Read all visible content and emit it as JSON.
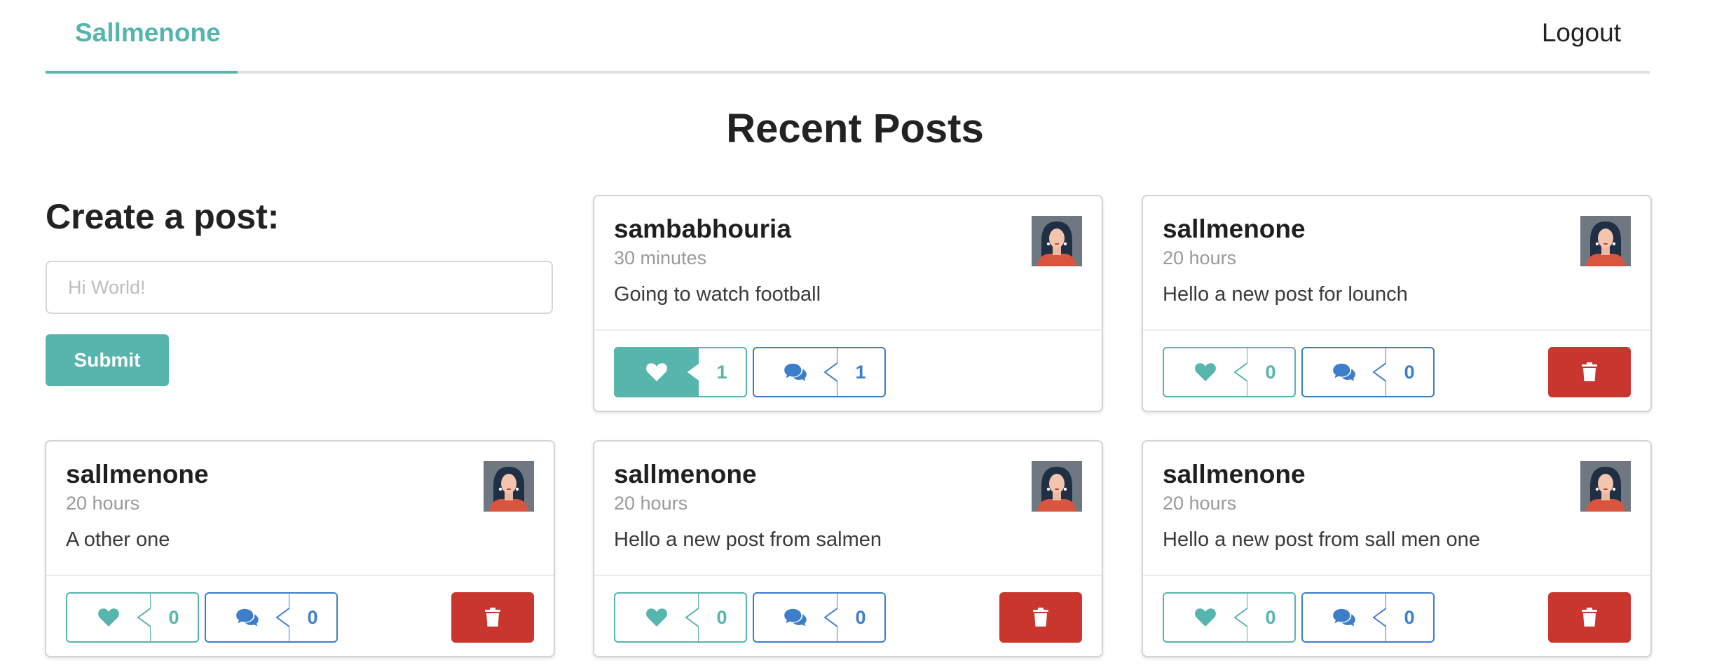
{
  "nav": {
    "home_label": "Sallmenone",
    "logout_label": "Logout"
  },
  "page_title": "Recent Posts",
  "create_post": {
    "title": "Create a post:",
    "input_placeholder": "Hi World!",
    "submit_label": "Submit"
  },
  "colors": {
    "accent": "#56b5ad",
    "comment_blue": "#3d7ecb",
    "delete_red": "#c9362e"
  },
  "icons": {
    "like": "heart-icon",
    "comment": "comments-icon",
    "delete": "trash-icon",
    "avatar": "avatar-woman"
  },
  "posts": [
    {
      "username": "sambabhouria",
      "time": "30 minutes",
      "body": "Going to watch football",
      "likes": "1",
      "comments": "1",
      "liked": true,
      "deletable": false
    },
    {
      "username": "sallmenone",
      "time": "20 hours",
      "body": "Hello a new post for lounch",
      "likes": "0",
      "comments": "0",
      "liked": false,
      "deletable": true
    },
    {
      "username": "sallmenone",
      "time": "20 hours",
      "body": "A other one",
      "likes": "0",
      "comments": "0",
      "liked": false,
      "deletable": true
    },
    {
      "username": "sallmenone",
      "time": "20 hours",
      "body": "Hello a new post from salmen",
      "likes": "0",
      "comments": "0",
      "liked": false,
      "deletable": true
    },
    {
      "username": "sallmenone",
      "time": "20 hours",
      "body": "Hello a new post from sall men one",
      "likes": "0",
      "comments": "0",
      "liked": false,
      "deletable": true
    }
  ]
}
